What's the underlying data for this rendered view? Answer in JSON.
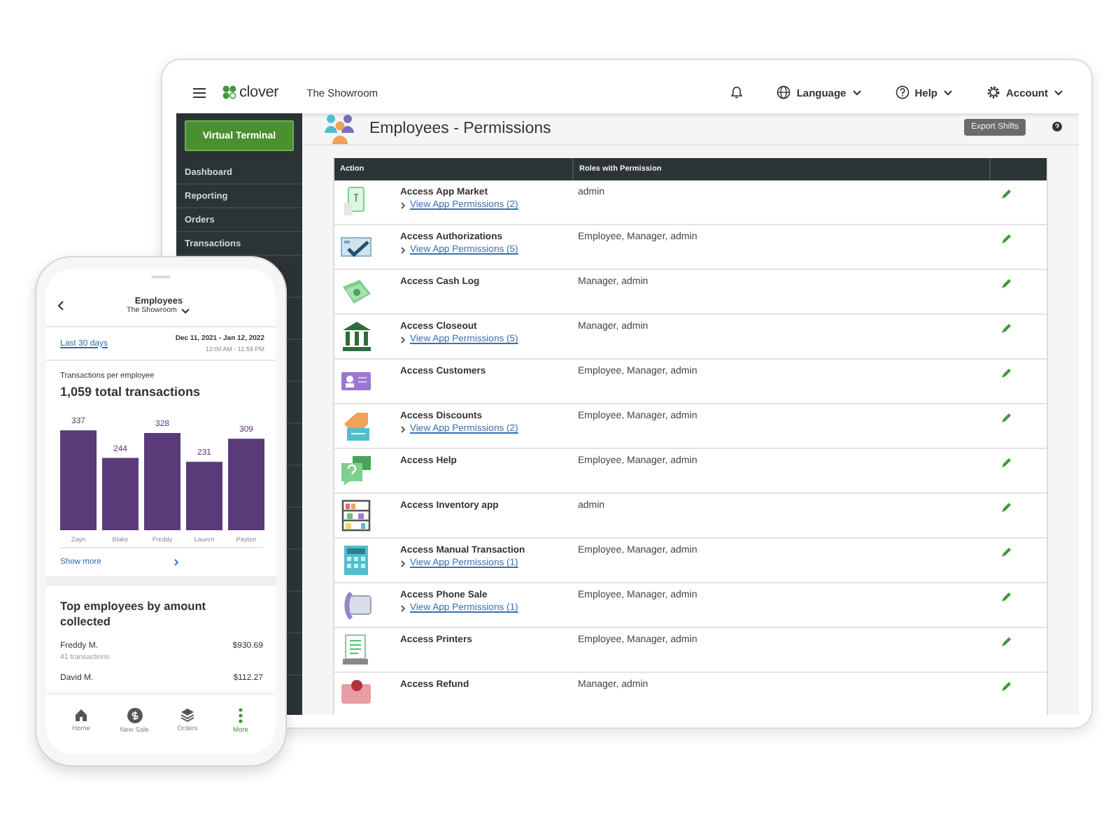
{
  "tablet": {
    "top_bar": {
      "logo": "clover",
      "location": "The Showroom",
      "menus": [
        {
          "label": "Language"
        },
        {
          "label": "Help"
        },
        {
          "label": "Account"
        }
      ]
    },
    "sidebar": {
      "button": "Virtual Terminal",
      "items": [
        {
          "label": "Dashboard"
        },
        {
          "label": "Reporting"
        },
        {
          "label": "Orders"
        },
        {
          "label": "Transactions"
        }
      ]
    },
    "page": {
      "title": "Employees - Permissions",
      "export_button": "Export Shifts"
    },
    "table": {
      "columns": [
        "Action",
        "Roles with Permission"
      ],
      "rows": [
        {
          "action": "Access App Market",
          "link": "View App Permissions (2)",
          "roles": "admin"
        },
        {
          "action": "Access Authorizations",
          "link": "View App Permissions (5)",
          "roles": "Employee, Manager, admin"
        },
        {
          "action": "Access Cash Log",
          "roles": "Manager, admin"
        },
        {
          "action": "Access Closeout",
          "link": "View App Permissions (5)",
          "roles": "Manager, admin"
        },
        {
          "action": "Access Customers",
          "roles": "Employee, Manager, admin"
        },
        {
          "action": "Access Discounts",
          "link": "View App Permissions (2)",
          "roles": "Employee, Manager, admin"
        },
        {
          "action": "Access Help",
          "roles": "Employee, Manager, admin"
        },
        {
          "action": "Access Inventory app",
          "roles": "admin"
        },
        {
          "action": "Access Manual Transaction",
          "link": "View App Permissions (1)",
          "roles": "Employee, Manager, admin"
        },
        {
          "action": "Access Phone Sale",
          "link": "View App Permissions (1)",
          "roles": "Employee, Manager, admin"
        },
        {
          "action": "Access Printers",
          "roles": "Employee, Manager, admin"
        },
        {
          "action": "Access Refund",
          "roles": "Manager, admin"
        }
      ]
    }
  },
  "phone": {
    "header": {
      "title": "Employees",
      "subtitle": "The Showroom"
    },
    "range": {
      "link": "Last 30 days",
      "dates": "Dec 11, 2021 - Jan 12, 2022",
      "times": "12:00 AM - 11:59 PM"
    },
    "chart_label": "Transactions per employee",
    "chart_total": "1,059 total transactions",
    "chart_data": {
      "type": "bar",
      "categories": [
        "Zayn",
        "Blake",
        "Freddy",
        "Lauren",
        "Payton"
      ],
      "values": [
        337,
        244,
        328,
        231,
        309
      ],
      "ylim": [
        0,
        340
      ],
      "data_labels": true
    },
    "show_more": "Show more",
    "top_title": "Top employees by amount collected",
    "top_employees": [
      {
        "name": "Freddy M.",
        "detail": "41 transactions",
        "amount": "$930.69"
      },
      {
        "name": "David M.",
        "amount": "$112.27"
      }
    ],
    "nav": [
      {
        "label": "Home",
        "selected": false
      },
      {
        "label": "New Sale",
        "selected": false
      },
      {
        "label": "Orders",
        "selected": false
      },
      {
        "label": "More",
        "selected": true
      }
    ]
  }
}
